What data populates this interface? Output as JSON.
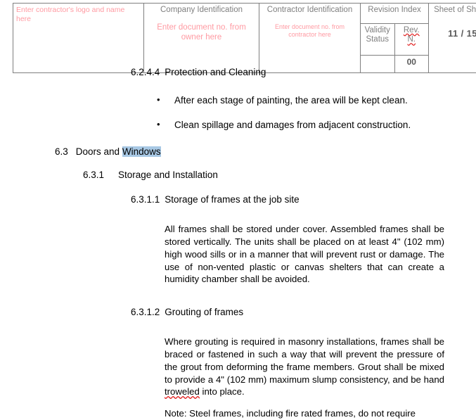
{
  "header_table": {
    "columns": [
      {
        "label": "",
        "placeholder": "Enter contractor's logo and name here"
      },
      {
        "label": "Company Identification",
        "placeholder": "Enter document no. from owner here"
      },
      {
        "label": "Contractor Identification",
        "placeholder": "Enter document no. from contractor here"
      },
      {
        "label": "Revision Index"
      },
      {
        "label": "Sheet  of Sheets"
      }
    ],
    "logo_placeholder": "Enter contractor's logo and name here",
    "company_label": "Company Identification",
    "company_placeholder": "Enter document no. from owner here",
    "contractor_label": "Contractor Identification",
    "contractor_placeholder": "Enter document no. from contractor here",
    "revision_index_label": "Revision Index",
    "validity_status_label_line1": "Validity",
    "validity_status_label_line2": "Status",
    "rev_n_label_line1": "Rev.",
    "rev_n_label_line2": "N.",
    "rev_number": "00",
    "sheet_label": "Sheet  of Sheets",
    "sheet_value": "11 / 15",
    "colors": {
      "border": "#7f7f7f",
      "label_text": "#7f7f7f",
      "placeholder_text": "#ff9aa2",
      "value_text": "#5a5a5a",
      "spellcheck_underline": "#e01b1b"
    }
  },
  "document": {
    "section_6244": {
      "number": "6.2.4.4",
      "title": "Protection and Cleaning",
      "bullets": [
        "After each stage of painting, the area will be kept clean.",
        "Clean spillage and damages from adjacent construction."
      ]
    },
    "section_63": {
      "number": "6.3",
      "title_plain": "Doors and ",
      "title_selected": "Windows"
    },
    "section_631": {
      "number": "6.3.1",
      "title": "Storage and Installation"
    },
    "section_6311": {
      "number": "6.3.1.1",
      "title": "Storage of frames at the job site",
      "body": "All frames shall be stored under cover. Assembled frames shall be stored vertically.  The  units  shall  be placed on at least 4\" (102 mm)  high  wood  sills  or  in  a  manner that will  prevent rust or damage. The use of  non-vented plastic or canvas shelters that can create a humidity chamber shall be avoided."
    },
    "section_6312": {
      "number": "6.3.1.2",
      "title": "Grouting of frames",
      "body_part1": "Where grouting is required in masonry installations, frames shall be braced or fastened in such a way that will prevent the pressure of the grout from deforming the frame members. Grout shall be mixed to provide a 4\" (102 mm) maximum slump consistency, and be hand ",
      "body_misspelled": "troweled",
      "body_part2": " into place."
    },
    "note_clipped": "Note: Steel frames, including fire rated frames, do not require"
  },
  "selection": {
    "highlight_color": "#a8c8e4",
    "selected_text": "Windows"
  }
}
